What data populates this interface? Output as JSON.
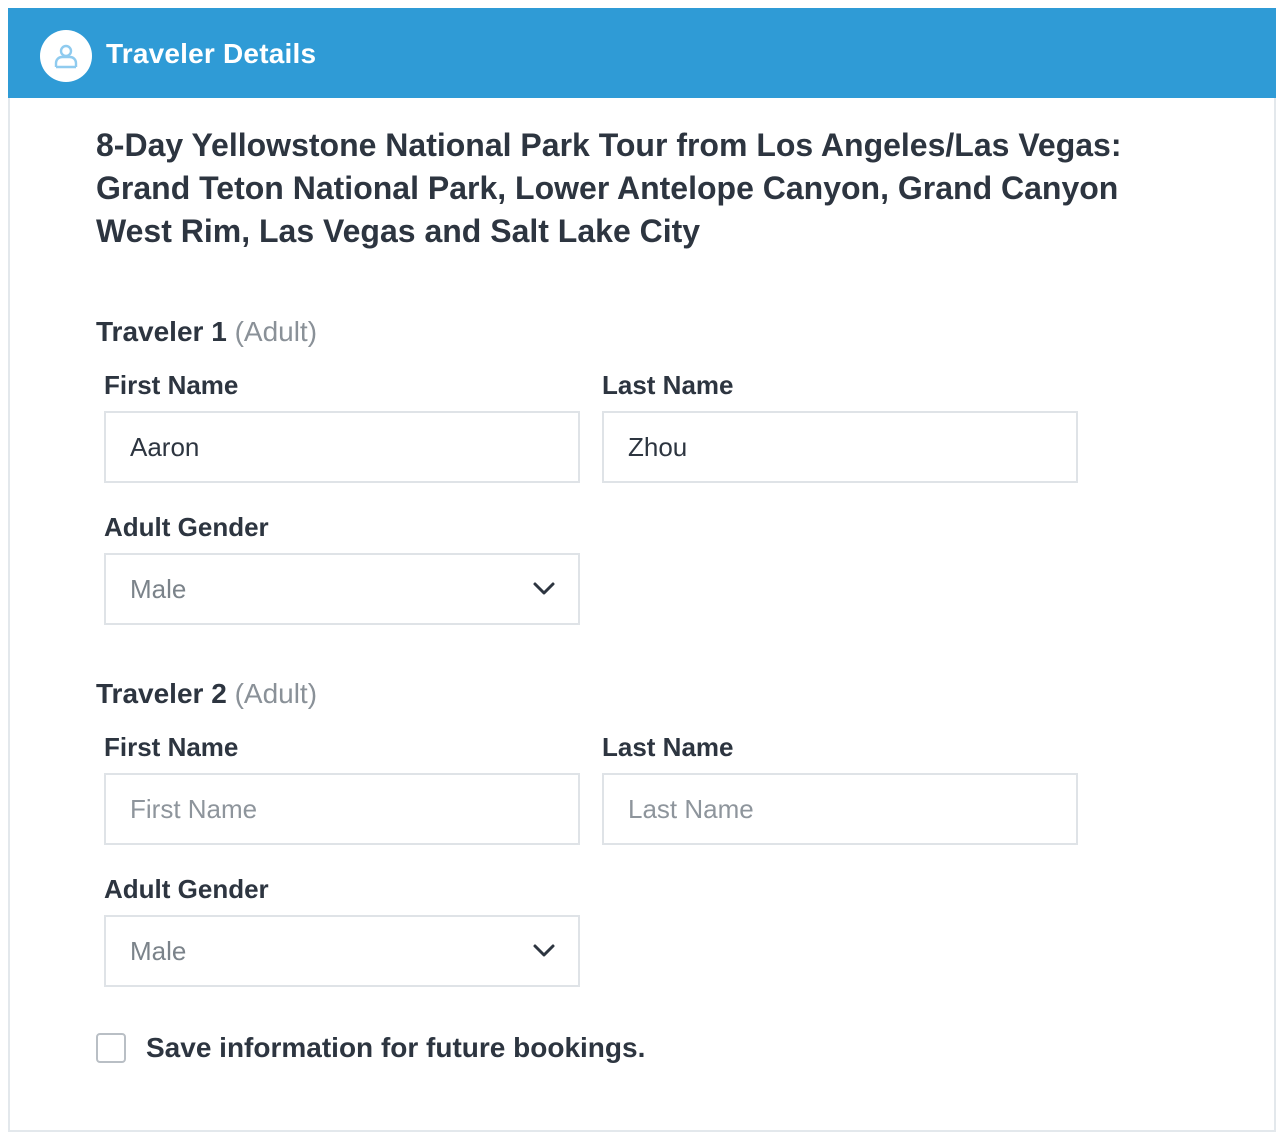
{
  "header": {
    "title": "Traveler Details",
    "icon": "user-icon",
    "color": "#2f9bd6"
  },
  "tour": {
    "title": "8-Day Yellowstone National Park Tour from Los Angeles/Las Vegas: Grand Teton National Park, Lower Antelope Canyon, Grand Canyon West Rim, Las Vegas and Salt Lake City"
  },
  "travelers": [
    {
      "heading": "Traveler 1",
      "type": "(Adult)",
      "first_name_label": "First Name",
      "first_name_value": "Aaron",
      "first_name_placeholder": "First Name",
      "last_name_label": "Last Name",
      "last_name_value": "Zhou",
      "last_name_placeholder": "Last Name",
      "gender_label": "Adult Gender",
      "gender_value": "Male"
    },
    {
      "heading": "Traveler 2",
      "type": "(Adult)",
      "first_name_label": "First Name",
      "first_name_value": "",
      "first_name_placeholder": "First Name",
      "last_name_label": "Last Name",
      "last_name_value": "",
      "last_name_placeholder": "Last Name",
      "gender_label": "Adult Gender",
      "gender_value": "Male"
    }
  ],
  "save_info": {
    "label": "Save information for future bookings.",
    "checked": false
  }
}
